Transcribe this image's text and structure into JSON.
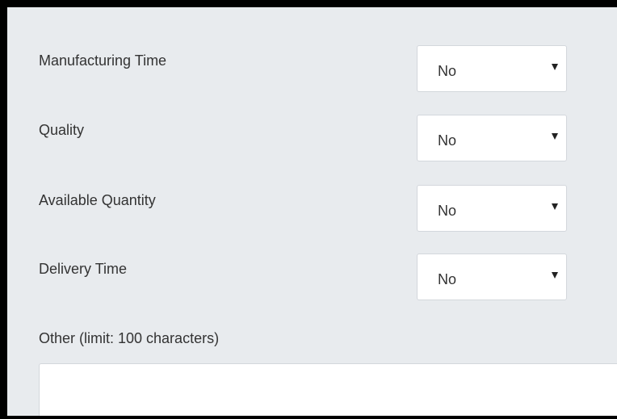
{
  "fields": [
    {
      "label": "Manufacturing Time",
      "value": "No"
    },
    {
      "label": "Quality",
      "value": "No"
    },
    {
      "label": "Available Quantity",
      "value": "No"
    },
    {
      "label": "Delivery Time",
      "value": "No"
    }
  ],
  "other": {
    "label": "Other (limit: 100 characters)",
    "value": ""
  },
  "icons": {
    "dropdown": "caret-down-icon"
  },
  "colors": {
    "panel_background": "#e8ebee",
    "frame": "#000000",
    "text": "#333333",
    "input_background": "#ffffff",
    "input_border": "#d3d7dc"
  }
}
